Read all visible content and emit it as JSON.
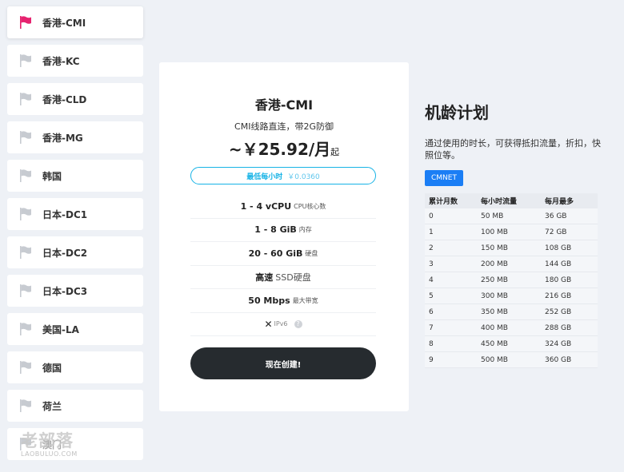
{
  "sidebar": {
    "items": [
      {
        "label": "香港-CMI",
        "active": true
      },
      {
        "label": "香港-KC"
      },
      {
        "label": "香港-CLD"
      },
      {
        "label": "香港-MG"
      },
      {
        "label": "韩国"
      },
      {
        "label": "日本-DC1"
      },
      {
        "label": "日本-DC2"
      },
      {
        "label": "日本-DC3"
      },
      {
        "label": "美国-LA"
      },
      {
        "label": "德国"
      },
      {
        "label": "荷兰"
      },
      {
        "label": "澳门"
      }
    ]
  },
  "watermark": {
    "big": "老部落",
    "small": "LAOBULUO.COM"
  },
  "plan": {
    "title": "香港-CMI",
    "subtitle": "CMI线路直连，带2G防御",
    "price_prefix": "~",
    "price": "￥25.92/月",
    "price_suffix": "起",
    "hourly_label": "最低每小时",
    "hourly_value": "￥0.0360",
    "specs": [
      {
        "main": "1 - 4 vCPU",
        "unit": "CPU核心数"
      },
      {
        "main": "1 - 8 GiB",
        "unit": "内存"
      },
      {
        "main": "20 - 60 GiB",
        "unit": "硬盘"
      },
      {
        "main": "高速",
        "unit": "SSD硬盘"
      },
      {
        "main": "50 Mbps",
        "unit": "最大带宽"
      }
    ],
    "ipv6_mark": "✕",
    "ipv6_label": "IPv6",
    "help_mark": "?",
    "create_label": "现在创建!"
  },
  "loyalty": {
    "title": "机龄计划",
    "desc": "通过使用的时长，可获得抵扣流量，折扣，快照位等。",
    "tab_label": "CMNET",
    "headers": [
      "累计月数",
      "每小时流量",
      "每月最多"
    ],
    "rows": [
      [
        "0",
        "50 MB",
        "36 GB"
      ],
      [
        "1",
        "100 MB",
        "72 GB"
      ],
      [
        "2",
        "150 MB",
        "108 GB"
      ],
      [
        "3",
        "200 MB",
        "144 GB"
      ],
      [
        "4",
        "250 MB",
        "180 GB"
      ],
      [
        "5",
        "300 MB",
        "216 GB"
      ],
      [
        "6",
        "350 MB",
        "252 GB"
      ],
      [
        "7",
        "400 MB",
        "288 GB"
      ],
      [
        "8",
        "450 MB",
        "324 GB"
      ],
      [
        "9",
        "500 MB",
        "360 GB"
      ]
    ]
  },
  "colors": {
    "accent": "#17b3e6",
    "flag_active": "#e6226f",
    "flag_inactive": "#c7cbd1",
    "button_dark": "#262b2f",
    "tab_blue": "#1b7ef5"
  }
}
